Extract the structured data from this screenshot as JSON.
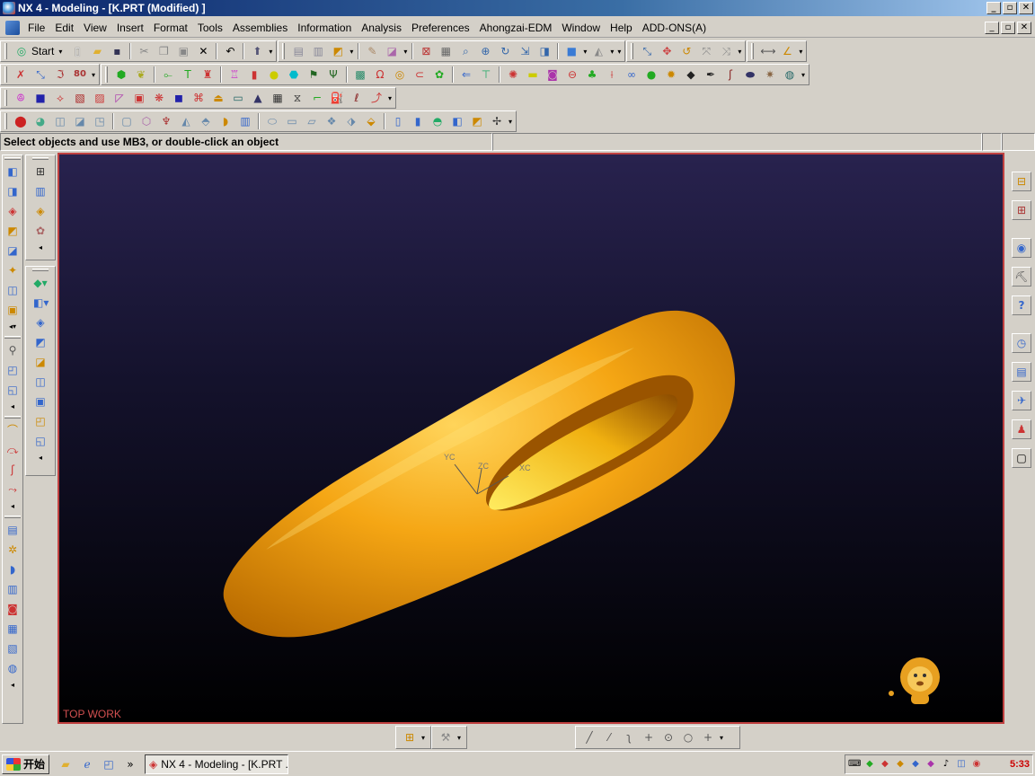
{
  "window": {
    "title": "NX 4 - Modeling - [K.PRT (Modified) ]",
    "minimize": "_",
    "maximize": "▫",
    "close": "✕"
  },
  "menu": {
    "items": [
      {
        "label": "File"
      },
      {
        "label": "Edit"
      },
      {
        "label": "View"
      },
      {
        "label": "Insert"
      },
      {
        "label": "Format"
      },
      {
        "label": "Tools"
      },
      {
        "label": "Assemblies"
      },
      {
        "label": "Information"
      },
      {
        "label": "Analysis"
      },
      {
        "label": "Preferences"
      },
      {
        "label": "Ahongzai-EDM"
      },
      {
        "label": "Window"
      },
      {
        "label": "Help"
      },
      {
        "label": "ADD-ONS(A)"
      }
    ]
  },
  "toolbar": {
    "start_label": "Start",
    "drop_arrow": "▾"
  },
  "status": {
    "message": "Select objects and use MB3, or double-click an object"
  },
  "viewport": {
    "view_name": "TOP WORK",
    "axis_x": "XC",
    "axis_y": "YC",
    "axis_z": "ZC",
    "background_top": "#28224e",
    "background_bottom": "#000000",
    "model_color": "#f0a818"
  },
  "taskbar": {
    "start_label": "开始",
    "chevron": "»",
    "task_label": "NX 4 - Modeling - [K.PRT ...",
    "clock": "5:33"
  }
}
